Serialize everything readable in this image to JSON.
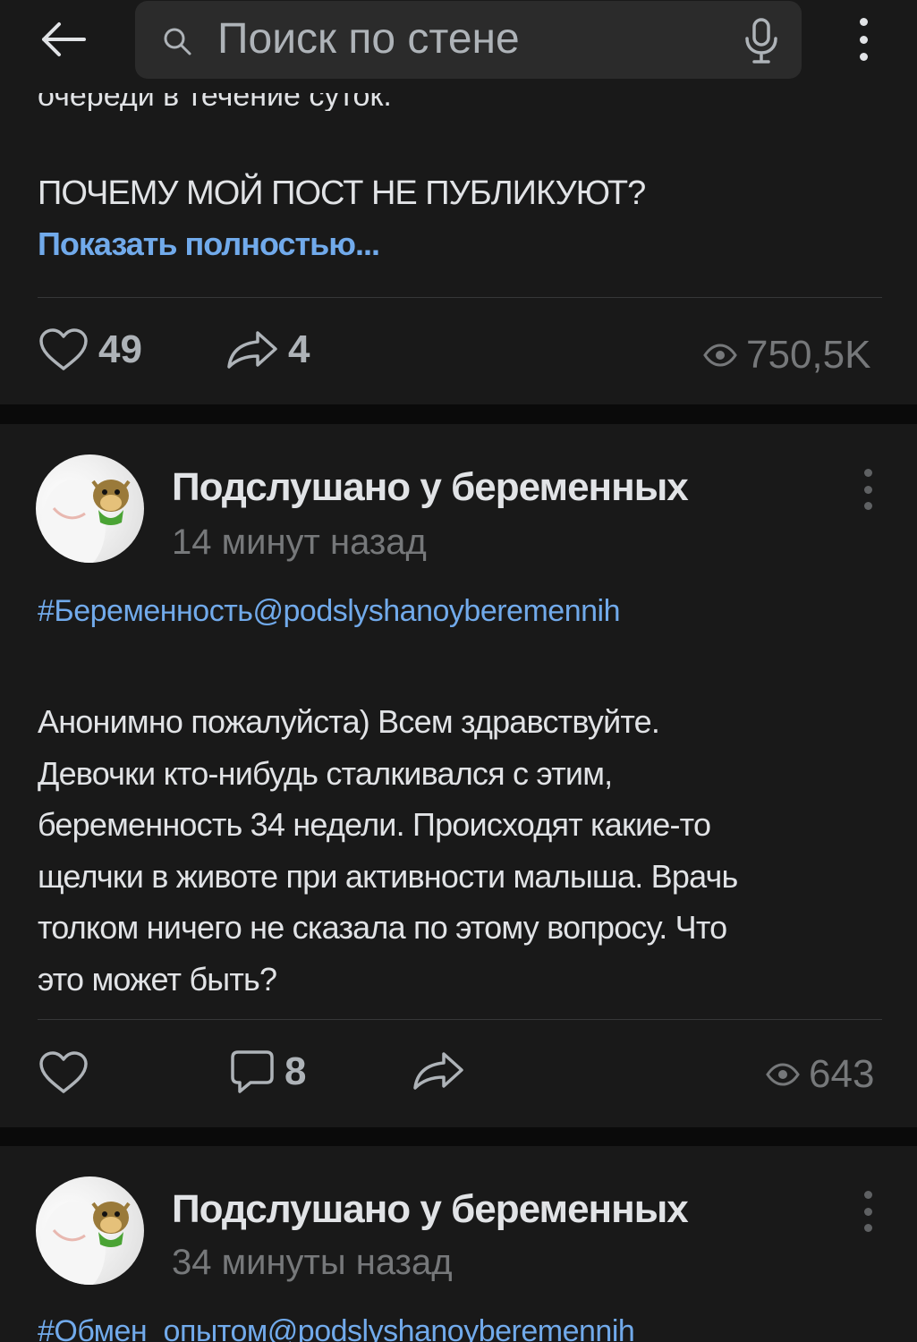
{
  "header": {
    "search_placeholder": "Поиск по стене",
    "icons": {
      "back": "arrow-left-icon",
      "search": "search-icon",
      "mic": "microphone-icon",
      "menu": "more-vertical-icon"
    }
  },
  "post1": {
    "clipped_text": "очереди в течение суток.",
    "title_line": "ПОЧЕМУ МОЙ ПОСТ НЕ ПУБЛИКУЮТ?",
    "show_more": "Показать полностью...",
    "likes": "49",
    "shares": "4",
    "views": "750,5K"
  },
  "post2": {
    "group": "Подслушано у беременных",
    "time": "14 минут назад",
    "hashtag": "#Беременность@podslyshanoyberemennih",
    "text_lines": [
      "Анонимно пожалуйста) Всем здравствуйте.",
      "Девочки кто-нибудь сталкивался с этим,",
      "беременность 34 недели. Происходят какие-то",
      "щелчки в животе при активности малыша. Врачь",
      "толком ничего не сказала по этому вопросу. Что",
      "это может быть?"
    ],
    "comments": "8",
    "views": "643"
  },
  "post3": {
    "group": "Подслушано у беременных",
    "time": "34 минуты назад",
    "hashtag": "#Обмен_опытом@podslyshanoyberemennih"
  },
  "colors": {
    "background": "#0a0a0a",
    "card": "#191919",
    "text": "#e1e3e6",
    "link": "#71aaeb",
    "secondary": "#76787a"
  }
}
